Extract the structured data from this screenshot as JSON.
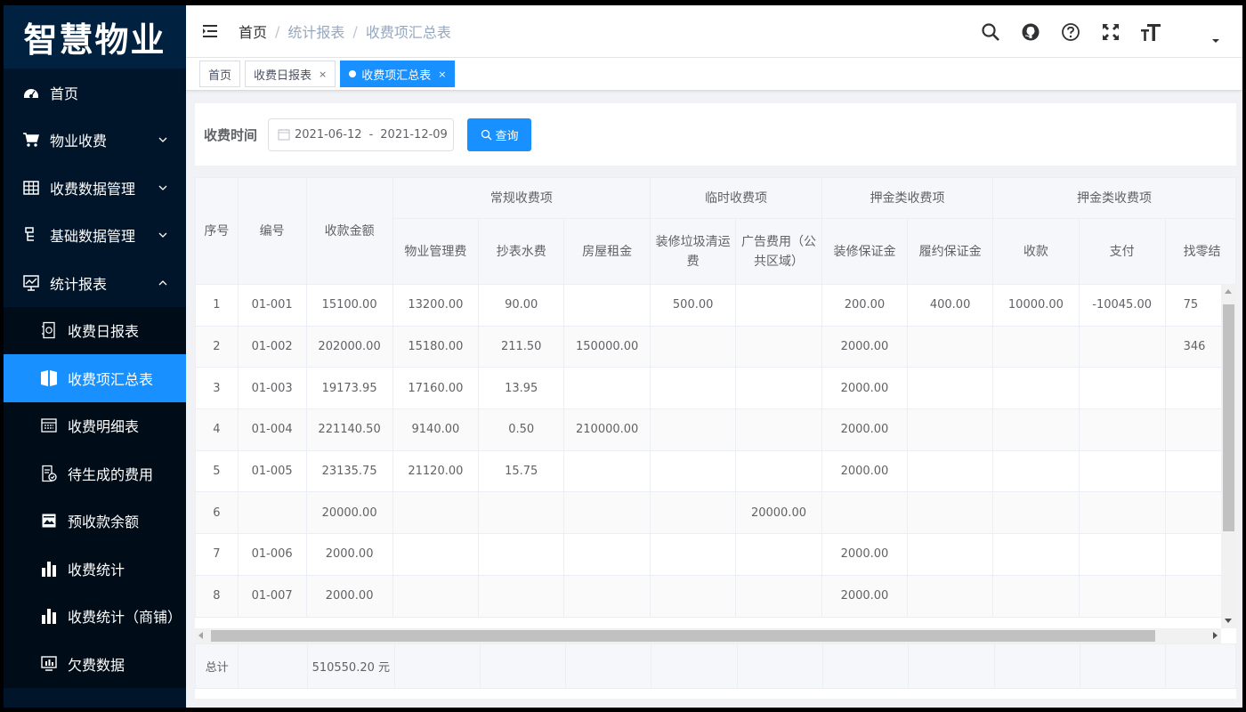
{
  "app": {
    "logo": "智慧物业"
  },
  "sidebar": {
    "items": [
      {
        "label": "首页",
        "icon": "dashboard-icon"
      },
      {
        "label": "物业收费",
        "icon": "cart-icon"
      },
      {
        "label": "收费数据管理",
        "icon": "grid-icon"
      },
      {
        "label": "基础数据管理",
        "icon": "tree-icon"
      },
      {
        "label": "统计报表",
        "icon": "chart-monitor-icon"
      }
    ],
    "submenu": [
      {
        "label": "收费日报表",
        "icon": "daily-report-icon"
      },
      {
        "label": "收费项汇总表",
        "icon": "summary-book-icon"
      },
      {
        "label": "收费明细表",
        "icon": "detail-list-icon"
      },
      {
        "label": "待生成的费用",
        "icon": "pending-doc-icon"
      },
      {
        "label": "预收款余额",
        "icon": "balance-image-icon"
      },
      {
        "label": "收费统计",
        "icon": "bar-chart-icon"
      },
      {
        "label": "收费统计（商铺）",
        "icon": "bar-chart-icon"
      },
      {
        "label": "欠费数据",
        "icon": "arrears-chart-icon"
      }
    ]
  },
  "header": {
    "breadcrumb": [
      "首页",
      "统计报表",
      "收费项汇总表"
    ]
  },
  "tags": [
    {
      "label": "首页"
    },
    {
      "label": "收费日报表",
      "close": "×"
    },
    {
      "label": "收费项汇总表",
      "close": "×"
    }
  ],
  "filter": {
    "label": "收费时间",
    "start_date": "2021-06-12",
    "separator": "-",
    "end_date": "2021-12-09",
    "query_label": "查询"
  },
  "table": {
    "group_headers": [
      "常规收费项",
      "临时收费项",
      "押金类收费项",
      "押金类收费项"
    ],
    "fixed_headers": [
      "序号",
      "编号",
      "收款金额"
    ],
    "sub_headers": [
      "物业管理费",
      "抄表水费",
      "房屋租金",
      "装修垃圾清运费",
      "广告费用（公共区域）",
      "装修保证金",
      "履约保证金",
      "收款",
      "支付",
      "找零结"
    ],
    "rows": [
      [
        "1",
        "01-001",
        "15100.00",
        "13200.00",
        "90.00",
        "",
        "500.00",
        "",
        "200.00",
        "400.00",
        "10000.00",
        "-10045.00",
        "75"
      ],
      [
        "2",
        "01-002",
        "202000.00",
        "15180.00",
        "211.50",
        "150000.00",
        "",
        "",
        "2000.00",
        "",
        "",
        "",
        "346"
      ],
      [
        "3",
        "01-003",
        "19173.95",
        "17160.00",
        "13.95",
        "",
        "",
        "",
        "2000.00",
        "",
        "",
        "",
        ""
      ],
      [
        "4",
        "01-004",
        "221140.50",
        "9140.00",
        "0.50",
        "210000.00",
        "",
        "",
        "2000.00",
        "",
        "",
        "",
        ""
      ],
      [
        "5",
        "01-005",
        "23135.75",
        "21120.00",
        "15.75",
        "",
        "",
        "",
        "2000.00",
        "",
        "",
        "",
        ""
      ],
      [
        "6",
        "",
        "20000.00",
        "",
        "",
        "",
        "",
        "20000.00",
        "",
        "",
        "",
        "",
        ""
      ],
      [
        "7",
        "01-006",
        "2000.00",
        "",
        "",
        "",
        "",
        "",
        "2000.00",
        "",
        "",
        "",
        ""
      ],
      [
        "8",
        "01-007",
        "2000.00",
        "",
        "",
        "",
        "",
        "",
        "2000.00",
        "",
        "",
        "",
        ""
      ]
    ],
    "footer": [
      "总计",
      "",
      "510550.20 元"
    ]
  }
}
